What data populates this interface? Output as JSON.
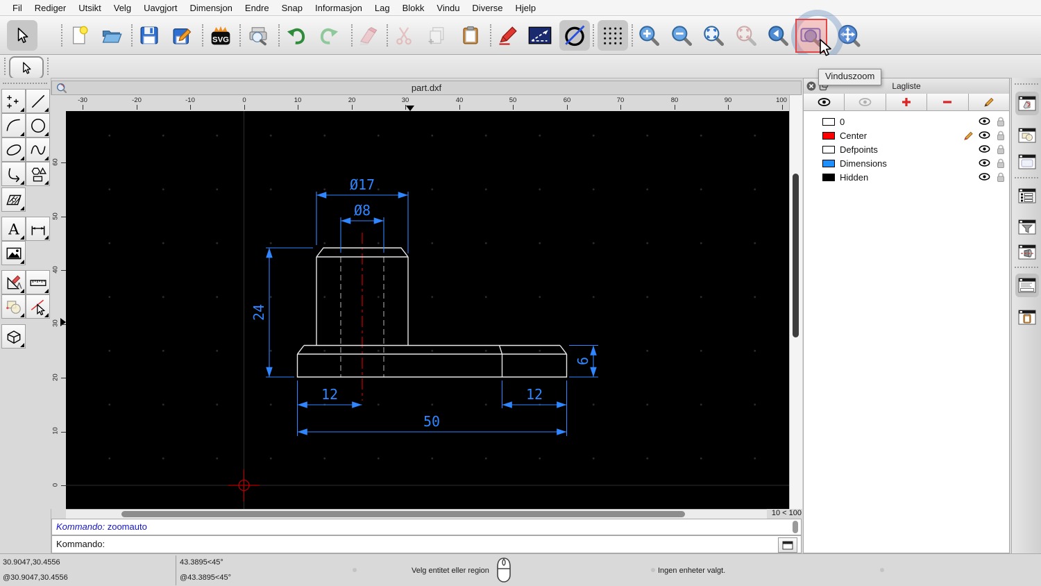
{
  "menu": {
    "items": [
      "Fil",
      "Rediger",
      "Utsikt",
      "Velg",
      "Uavgjort",
      "Dimensjon",
      "Endre",
      "Snap",
      "Informasjon",
      "Lag",
      "Blokk",
      "Vindu",
      "Diverse",
      "Hjelp"
    ]
  },
  "toolbar": {
    "tooltip": "Vinduszoom",
    "buttons": [
      "select",
      "new-document",
      "open",
      "save",
      "save-as",
      "export-svg",
      "print-preview",
      "undo",
      "redo",
      "delete",
      "cut",
      "copy",
      "paste",
      "draw-pencil",
      "draw-line",
      "draw-circle",
      "grid-toggle",
      "zoom-in",
      "zoom-out",
      "zoom-auto",
      "zoom-previous",
      "zoom-back",
      "window-zoom",
      "pan"
    ]
  },
  "document_window": {
    "title": "part.dxf",
    "zoom_indicator": "10 < 100"
  },
  "rulers": {
    "horizontal": [
      "-30",
      "-20",
      "-10",
      "0",
      "10",
      "20",
      "30",
      "40",
      "50",
      "60",
      "70",
      "80",
      "90",
      "100"
    ],
    "vertical": [
      "60",
      "50",
      "40",
      "30",
      "20",
      "10",
      "0"
    ]
  },
  "drawing": {
    "dimensions": {
      "phi17": "Ø17",
      "phi8": "Ø8",
      "height24": "24",
      "height6": "6",
      "left12": "12",
      "right12": "12",
      "width50": "50"
    },
    "colors": {
      "outline": "#e8e8e8",
      "dimension": "#2F86FF",
      "centerline": "#BB0000",
      "hidden": "#999999",
      "background": "#000000"
    }
  },
  "layer_panel": {
    "title": "Lagliste",
    "layers": [
      {
        "name": "0",
        "color": "#ffffff"
      },
      {
        "name": "Center",
        "color": "#ff0000",
        "current": true
      },
      {
        "name": "Defpoints",
        "color": "#ffffff"
      },
      {
        "name": "Dimensions",
        "color": "#1e90ff"
      },
      {
        "name": "Hidden",
        "color": "#000000"
      }
    ]
  },
  "command": {
    "history_label": "Kommando:",
    "history_entry": "zoomauto",
    "prompt_label": "Kommando:"
  },
  "status": {
    "abs_coord": "30.9047,30.4556",
    "rel_coord": "@30.9047,30.4556",
    "abs_polar": "43.3895<45°",
    "rel_polar": "@43.3895<45°",
    "hint": "Velg entitet eller region",
    "selection_info": "Ingen enheter valgt."
  },
  "icons": {
    "text_tool_glyph": "A",
    "svg_badge": "SVG"
  }
}
